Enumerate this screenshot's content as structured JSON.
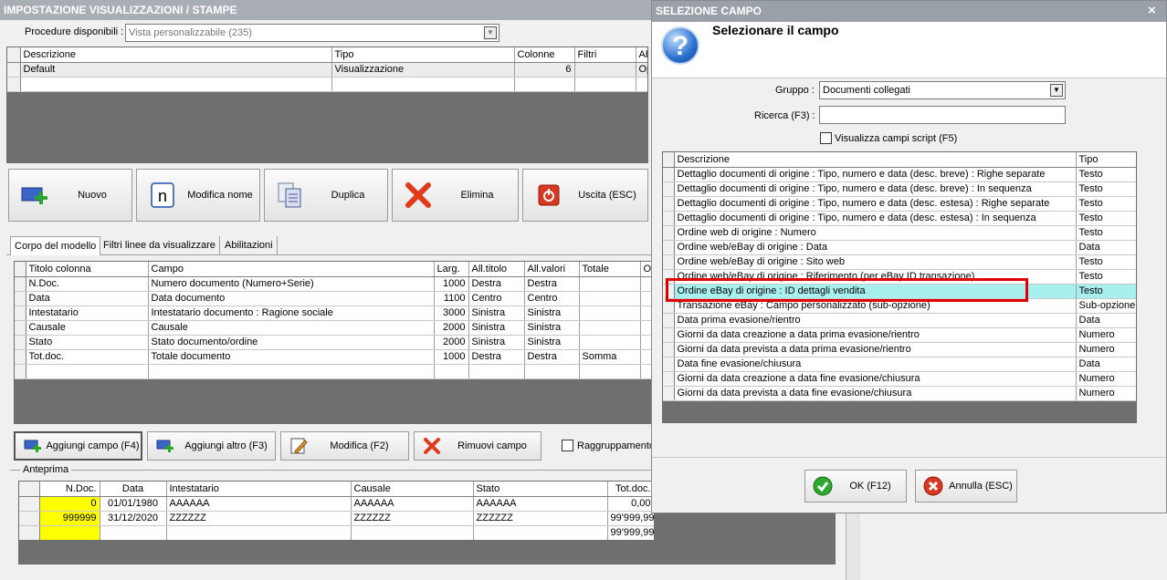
{
  "main": {
    "title": "IMPOSTAZIONE VISUALIZZAZIONI / STAMPE",
    "proc_label": "Procedure disponibili :",
    "proc_value": "Vista personalizzabile (235)",
    "views_headers": [
      "Descrizione",
      "Tipo",
      "Colonne",
      "Filtri",
      "Ab"
    ],
    "views_rows": [
      [
        "Default",
        "Visualizzazione",
        "6",
        "",
        "Op"
      ]
    ],
    "buttons": {
      "nuovo": "Nuovo",
      "modifica_nome": "Modifica nome",
      "duplica": "Duplica",
      "elimina": "Elimina",
      "uscita": "Uscita (ESC)"
    },
    "tabs": [
      "Corpo del modello",
      "Filtri linee da visualizzare",
      "Abilitazioni"
    ],
    "cols_headers": [
      "Titolo colonna",
      "Campo",
      "Larg.",
      "All.titolo",
      "All.valori",
      "Totale",
      "O"
    ],
    "cols_rows": [
      [
        "N.Doc.",
        "Numero documento (Numero+Serie)",
        "1000",
        "Destra",
        "Destra",
        ""
      ],
      [
        "Data",
        "Data documento",
        "1100",
        "Centro",
        "Centro",
        ""
      ],
      [
        "Intestatario",
        "Intestatario documento : Ragione sociale",
        "3000",
        "Sinistra",
        "Sinistra",
        ""
      ],
      [
        "Causale",
        "Causale",
        "2000",
        "Sinistra",
        "Sinistra",
        ""
      ],
      [
        "Stato",
        "Stato documento/ordine",
        "2000",
        "Sinistra",
        "Sinistra",
        ""
      ],
      [
        "Tot.doc.",
        "Totale documento",
        "1000",
        "Destra",
        "Destra",
        "Somma"
      ]
    ],
    "col_buttons": {
      "aggiungi": "Aggiungi campo (F4)",
      "aggiungi_altro": "Aggiungi altro (F3)",
      "modifica": "Modifica (F2)",
      "rimuovi": "Rimuovi campo"
    },
    "raggruppamento": "Raggruppamento",
    "anteprima_label": "Anteprima",
    "prev_headers": [
      "N.Doc.",
      "Data",
      "Intestatario",
      "Causale",
      "Stato",
      "Tot.doc."
    ],
    "prev_rows": [
      [
        "0",
        "01/01/1980",
        "AAAAAA",
        "AAAAAA",
        "AAAAAA",
        "0,00"
      ],
      [
        "999999",
        "31/12/2020",
        "ZZZZZZ",
        "ZZZZZZ",
        "ZZZZZZ",
        "99'999,99"
      ],
      [
        "",
        "",
        "",
        "",
        "",
        "99'999,99"
      ]
    ]
  },
  "dialog": {
    "title": "SELEZIONE CAMPO",
    "close": "×",
    "heading": "Selezionare il campo",
    "help_glyph": "?",
    "gruppo_label": "Gruppo :",
    "gruppo_value": "Documenti collegati",
    "ricerca_label": "Ricerca (F3) :",
    "ricerca_value": "",
    "script_label": "Visualizza campi script (F5)",
    "headers": [
      "Descrizione",
      "Tipo"
    ],
    "rows": [
      [
        "Dettaglio documenti di origine : Tipo, numero e data (desc. breve) : Righe separate",
        "Testo"
      ],
      [
        "Dettaglio documenti di origine : Tipo, numero e data (desc. breve) : In sequenza",
        "Testo"
      ],
      [
        "Dettaglio documenti di origine : Tipo, numero e data (desc. estesa) : Righe separate",
        "Testo"
      ],
      [
        "Dettaglio documenti di origine : Tipo, numero e data (desc. estesa) : In sequenza",
        "Testo"
      ],
      [
        "Ordine web di origine : Numero",
        "Testo"
      ],
      [
        "Ordine web/eBay di origine : Data",
        "Data"
      ],
      [
        "Ordine web/eBay di origine : Sito web",
        "Testo"
      ],
      [
        "Ordine web/eBay di origine : Riferimento (per eBay ID transazione)",
        "Testo"
      ],
      [
        "Ordine eBay di origine : ID dettagli vendita",
        "Testo"
      ],
      [
        "Transazione eBay : Campo personalizzato (sub-opzione)",
        "Sub-opzione"
      ],
      [
        "Data prima evasione/rientro",
        "Data"
      ],
      [
        "Giorni da data creazione a data prima evasione/rientro",
        "Numero"
      ],
      [
        "Giorni da data prevista a data prima evasione/rientro",
        "Numero"
      ],
      [
        "Data fine evasione/chiusura",
        "Data"
      ],
      [
        "Giorni da data creazione a data fine evasione/chiusura",
        "Numero"
      ],
      [
        "Giorni da data prevista a data fine evasione/chiusura",
        "Numero"
      ]
    ],
    "selected_index": 8,
    "ok": "OK (F12)",
    "annulla": "Annulla (ESC)"
  },
  "colors": {
    "titlebar": "#a9aeb4",
    "highlight": "#a8f0f0",
    "selection_border": "#e00000",
    "preview_key": "#ffff00"
  }
}
